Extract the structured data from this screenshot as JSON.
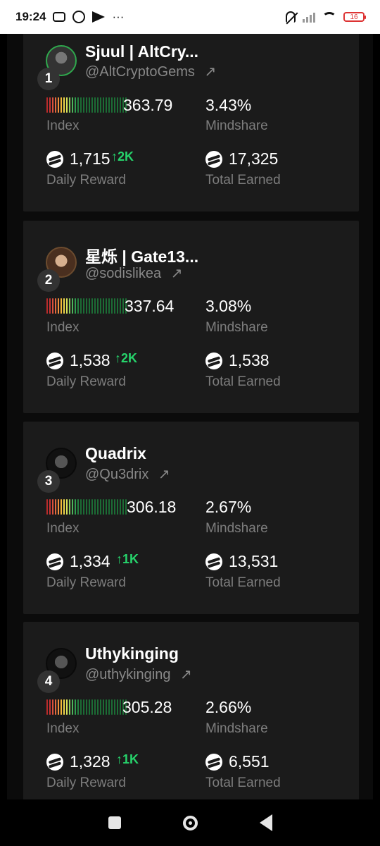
{
  "status": {
    "time": "19:24",
    "more": "···",
    "battery": "16"
  },
  "cards": [
    {
      "rank": "1",
      "name": "Sjuul | AltCry...",
      "handle": "@AltCryptoGems",
      "index": "363.79",
      "mindshare": "3.43%",
      "daily_reward": "1,715",
      "daily_delta": "↑2K",
      "total_earned": "17,325"
    },
    {
      "rank": "2",
      "name": "星烁 | Gate13...",
      "handle": "@sodislikea",
      "index": "337.64",
      "mindshare": "3.08%",
      "daily_reward": "1,538",
      "daily_delta": "↑2K",
      "total_earned": "1,538"
    },
    {
      "rank": "3",
      "name": "Quadrix",
      "handle": "@Qu3drix",
      "index": "306.18",
      "mindshare": "2.67%",
      "daily_reward": "1,334",
      "daily_delta": "↑1K",
      "total_earned": "13,531"
    },
    {
      "rank": "4",
      "name": "Uthykinging",
      "handle": "@uthykinging",
      "index": "305.28",
      "mindshare": "2.66%",
      "daily_reward": "1,328",
      "daily_delta": "↑1K",
      "total_earned": "6,551"
    }
  ],
  "labels": {
    "index": "Index",
    "mindshare": "Mindshare",
    "daily_reward": "Daily Reward",
    "total_earned": "Total Earned",
    "external_link_icon": "↗"
  }
}
